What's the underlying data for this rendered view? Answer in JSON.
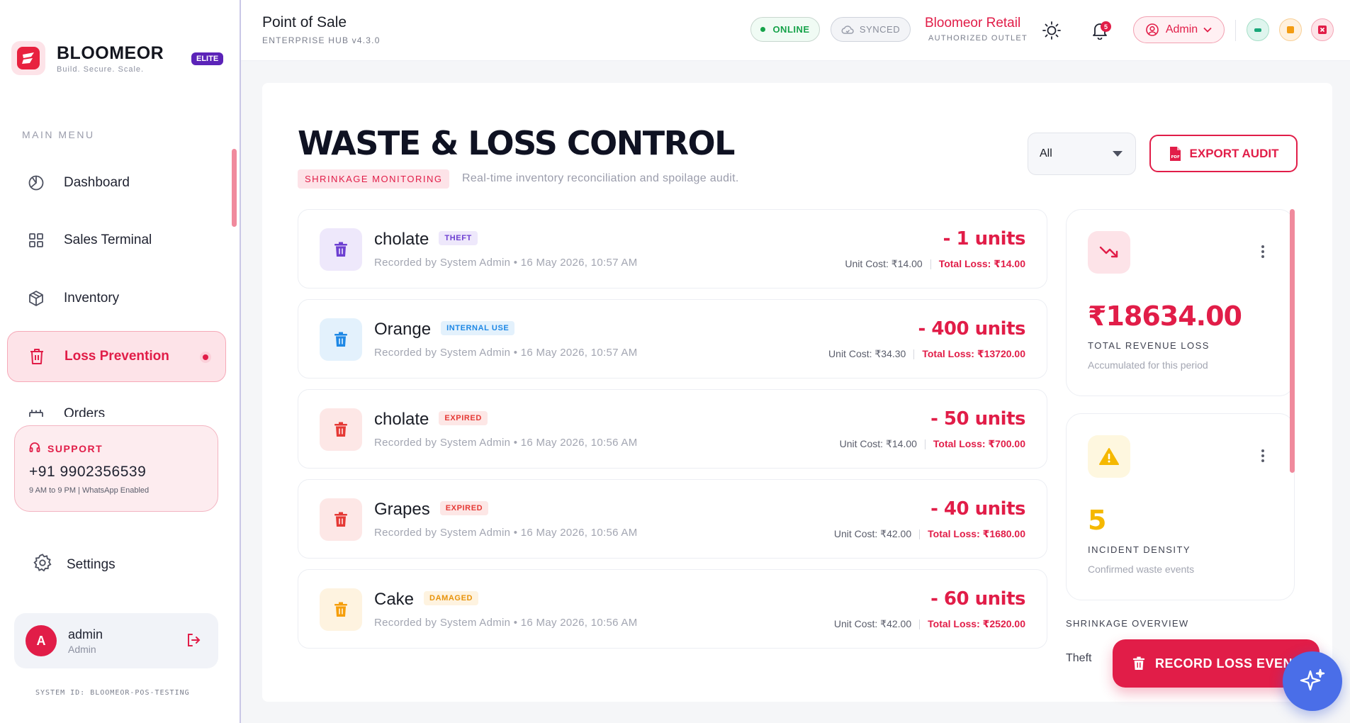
{
  "brand": {
    "name": "BLOOMEOR",
    "tagline": "Build. Secure. Scale.",
    "badge": "ELITE"
  },
  "sidebar": {
    "menu_title": "MAIN MENU",
    "items": [
      {
        "label": "Dashboard",
        "icon": "dashboard-icon"
      },
      {
        "label": "Sales Terminal",
        "icon": "grid-icon"
      },
      {
        "label": "Inventory",
        "icon": "box-icon"
      },
      {
        "label": "Loss Prevention",
        "icon": "trash-icon",
        "active": true
      },
      {
        "label": "Orders",
        "icon": "orders-icon"
      }
    ],
    "support": {
      "title": "SUPPORT",
      "phone": "+91 9902356539",
      "hours": "9 AM to 9 PM | WhatsApp Enabled"
    },
    "settings_label": "Settings",
    "user": {
      "initial": "A",
      "name": "admin",
      "role": "Admin"
    },
    "system_id": "SYSTEM ID: BLOOMEOR-POS-TESTING"
  },
  "header": {
    "title": "Point of Sale",
    "subtitle": "ENTERPRISE HUB v4.3.0",
    "status_online": "ONLINE",
    "status_synced": "SYNCED",
    "outlet_name": "Bloomeor Retail",
    "outlet_sub": "AUTHORIZED OUTLET",
    "notification_count": "5",
    "admin_label": "Admin"
  },
  "page": {
    "title": "WASTE & LOSS CONTROL",
    "badge": "SHRINKAGE MONITORING",
    "subtitle": "Real-time inventory reconciliation and spoilage audit.",
    "filter_value": "All",
    "export_label": "EXPORT AUDIT"
  },
  "events": [
    {
      "name": "cholate",
      "tag": "THEFT",
      "meta": "Recorded by System Admin • 16 May 2026, 10:57 AM",
      "qty": "- 1 units",
      "unit_cost": "Unit Cost: ₹14.00",
      "total_loss": "Total Loss: ₹14.00"
    },
    {
      "name": "Orange",
      "tag": "INTERNAL USE",
      "meta": "Recorded by System Admin • 16 May 2026, 10:57 AM",
      "qty": "- 400 units",
      "unit_cost": "Unit Cost: ₹34.30",
      "total_loss": "Total Loss: ₹13720.00"
    },
    {
      "name": "cholate",
      "tag": "EXPIRED",
      "meta": "Recorded by System Admin • 16 May 2026, 10:56 AM",
      "qty": "- 50 units",
      "unit_cost": "Unit Cost: ₹14.00",
      "total_loss": "Total Loss: ₹700.00"
    },
    {
      "name": "Grapes",
      "tag": "EXPIRED",
      "meta": "Recorded by System Admin • 16 May 2026, 10:56 AM",
      "qty": "- 40 units",
      "unit_cost": "Unit Cost: ₹42.00",
      "total_loss": "Total Loss: ₹1680.00"
    },
    {
      "name": "Cake",
      "tag": "DAMAGED",
      "meta": "Recorded by System Admin • 16 May 2026, 10:56 AM",
      "qty": "- 60 units",
      "unit_cost": "Unit Cost: ₹42.00",
      "total_loss": "Total Loss: ₹2520.00"
    }
  ],
  "stats": {
    "revenue_loss": {
      "value": "₹18634.00",
      "label": "TOTAL REVENUE LOSS",
      "note": "Accumulated for this period"
    },
    "incidents": {
      "value": "5",
      "label": "INCIDENT DENSITY",
      "note": "Confirmed waste events"
    }
  },
  "overview": {
    "title": "SHRINKAGE OVERVIEW",
    "first_label": "Theft"
  },
  "record_label": "RECORD LOSS EVENT",
  "colors": {
    "accent": "#e11d48",
    "theft": "#6d3fd1",
    "internal_use": "#1e88e5",
    "expired": "#e53935",
    "damaged": "#f59e0b",
    "incident": "#f5b800"
  }
}
